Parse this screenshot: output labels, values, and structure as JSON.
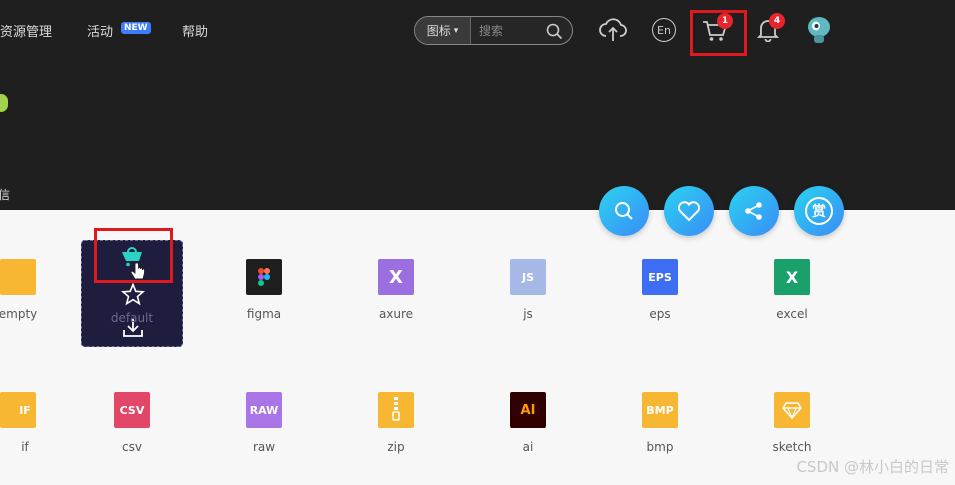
{
  "nav": {
    "resource_manage": "资源管理",
    "activity": "活动",
    "new_badge": "NEW",
    "help": "帮助"
  },
  "search": {
    "type_label": "图标",
    "placeholder": "搜索"
  },
  "header_icons": {
    "upload": "upload-icon",
    "language": "En",
    "cart_badge": "1",
    "bell_badge": "4"
  },
  "side_text": "信",
  "fab_buttons": [
    "search-icon",
    "heart-icon",
    "share-icon",
    "reward-icon"
  ],
  "fab_reward_char": "赏",
  "files_row1": [
    {
      "label": "empty",
      "icon_text": "",
      "color": "#f7b733"
    },
    {
      "label": "default",
      "icon_text": "",
      "color": "#1e1d3d"
    },
    {
      "label": "figma",
      "icon_text": "",
      "color": "#1e1e1e"
    },
    {
      "label": "axure",
      "icon_text": "X",
      "color": "#9b6fe0"
    },
    {
      "label": "js",
      "icon_text": "JS",
      "color": "#a5b8e6"
    },
    {
      "label": "eps",
      "icon_text": "EPS",
      "color": "#3d6df2"
    },
    {
      "label": "excel",
      "icon_text": "X",
      "color": "#1aa06b"
    }
  ],
  "files_row2": [
    {
      "label": "if",
      "icon_text": "IF",
      "color": "#f7b733"
    },
    {
      "label": "csv",
      "icon_text": "CSV",
      "color": "#e24769"
    },
    {
      "label": "raw",
      "icon_text": "RAW",
      "color": "#a974e6"
    },
    {
      "label": "zip",
      "icon_text": "",
      "color": "#f7b733"
    },
    {
      "label": "ai",
      "icon_text": "AI",
      "color": "#300000"
    },
    {
      "label": "bmp",
      "icon_text": "BMP",
      "color": "#f7b733"
    },
    {
      "label": "sketch",
      "icon_text": "",
      "color": "#f7b733"
    }
  ],
  "hover_actions": [
    "cart-icon",
    "star-icon",
    "download-icon"
  ],
  "watermark": "CSDN @林小白的日常"
}
